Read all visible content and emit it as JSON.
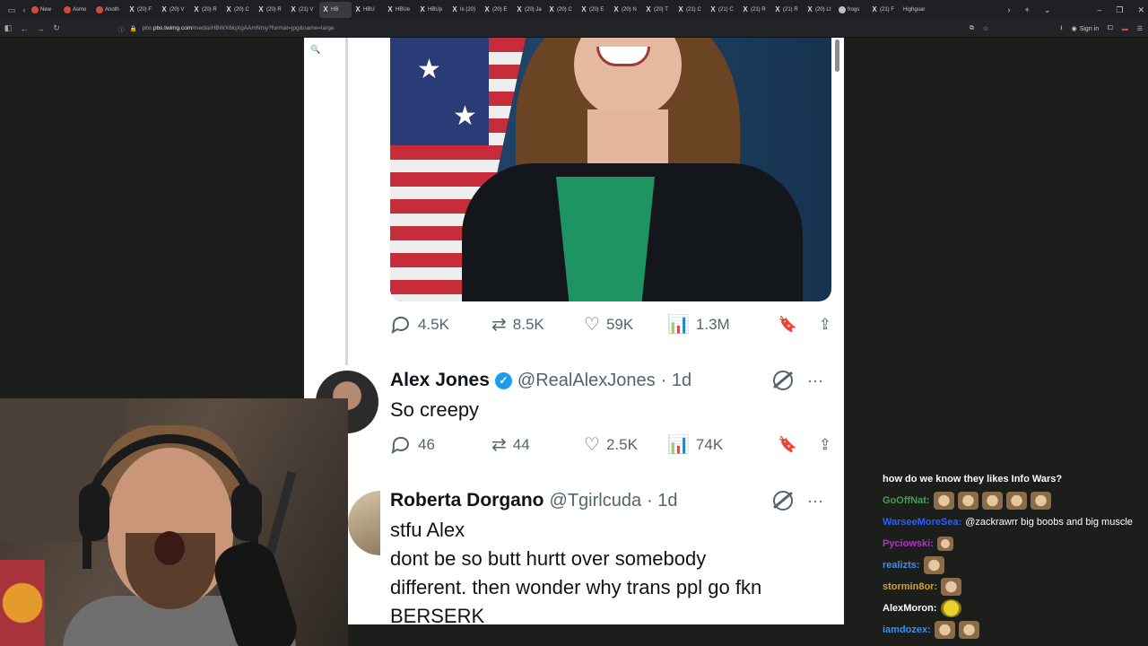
{
  "browser": {
    "tabs": [
      {
        "label": "New",
        "icon": "red"
      },
      {
        "label": "Asmo",
        "icon": "red"
      },
      {
        "label": "Anoth",
        "icon": "red"
      },
      {
        "label": "(20) F",
        "icon": "x"
      },
      {
        "label": "(20) V",
        "icon": "x"
      },
      {
        "label": "(20) R",
        "icon": "x"
      },
      {
        "label": "(20) C",
        "icon": "x"
      },
      {
        "label": "(20) R",
        "icon": "x"
      },
      {
        "label": "(21) V",
        "icon": "x"
      },
      {
        "label": "HB",
        "icon": "x",
        "active": true
      },
      {
        "label": "HBU",
        "icon": "x"
      },
      {
        "label": "HBUe",
        "icon": "x"
      },
      {
        "label": "HBUp",
        "icon": "x"
      },
      {
        "label": "Is (20)",
        "icon": "x"
      },
      {
        "label": "(20) E",
        "icon": "x"
      },
      {
        "label": "(20) Ja",
        "icon": "x"
      },
      {
        "label": "(20) C",
        "icon": "x"
      },
      {
        "label": "(20) E",
        "icon": "x"
      },
      {
        "label": "(20) N",
        "icon": "x"
      },
      {
        "label": "(20) T",
        "icon": "x"
      },
      {
        "label": "(21) C",
        "icon": "x"
      },
      {
        "label": "(21) C",
        "icon": "x"
      },
      {
        "label": "(21) R",
        "icon": "x"
      },
      {
        "label": "(21) R",
        "icon": "x"
      },
      {
        "label": "(20) Lt",
        "icon": "x"
      },
      {
        "label": "frogs",
        "icon": "globe"
      },
      {
        "label": "(21) F",
        "icon": "x"
      },
      {
        "label": "Highguar",
        "icon": "none"
      }
    ],
    "url_host": "pbs.twimg.com",
    "url_path": "/media/HBWX6lqXgAAmNmy?format=jpg&name=large",
    "url_prefix": "pbs.",
    "signin_label": "Sign in"
  },
  "tweet1_stats": {
    "replies": "4.5K",
    "retweets": "8.5K",
    "likes": "59K",
    "views": "1.3M"
  },
  "tweet2": {
    "name": "Alex Jones",
    "handle": "@RealAlexJones",
    "time": "· 1d",
    "text": "So creepy",
    "replies": "46",
    "retweets": "44",
    "likes": "2.5K",
    "views": "74K"
  },
  "tweet3": {
    "name": "Roberta Dorgano",
    "handle": "@Tgirlcuda",
    "time": "· 1d",
    "line1": "stfu Alex",
    "line2": "dont be so butt hurtt over somebody",
    "line3": "different. then wonder why trans ppl go fkn",
    "line4": "BERSERK"
  },
  "chat": {
    "header": "how do we know they likes Info Wars?",
    "messages": [
      {
        "user": "GoOffNat:",
        "color": "#3fa34d",
        "text": "",
        "emotes": 5
      },
      {
        "user": "WarseeMoreSea:",
        "color": "#2e5cff",
        "text": "@zackrawrr big boobs and big muscle",
        "emotes": 0
      },
      {
        "user": "Pyciowski:",
        "color": "#b530c9",
        "text": "",
        "emotes": 1
      },
      {
        "user": "realizts:",
        "color": "#3a8df0",
        "text": "",
        "emotes": 1
      },
      {
        "user": "stormin8or:",
        "color": "#d4a12a",
        "text": "",
        "emotes": 1
      },
      {
        "user": "AlexMoron:",
        "color": "#ffffff",
        "text": "",
        "emotes": 1
      },
      {
        "user": "iamdozex:",
        "color": "#3a8df0",
        "text": "",
        "emotes": 2
      }
    ]
  }
}
